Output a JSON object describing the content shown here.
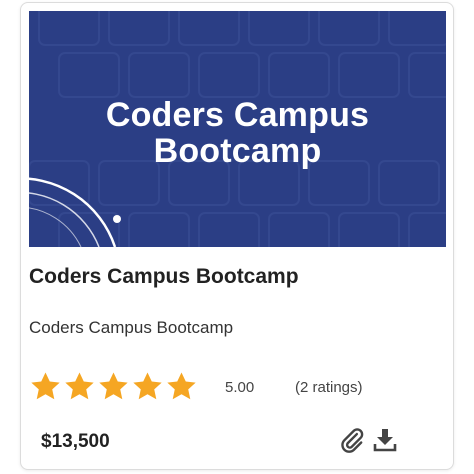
{
  "course": {
    "thumbnail_text_line1": "Coders Campus",
    "thumbnail_text_line2": "Bootcamp",
    "title": "Coders Campus Bootcamp",
    "subtitle": "Coders Campus Bootcamp",
    "rating": {
      "value": "5.00",
      "count_label": "(2 ratings)",
      "stars_filled": 5,
      "stars_total": 5
    },
    "price": "$13,500"
  },
  "icons": {
    "attachment": "paperclip-icon",
    "download": "download-icon"
  },
  "colors": {
    "thumbnail_bg": "#2b3e85",
    "star": "#f5a623",
    "text_dark": "#222222"
  }
}
